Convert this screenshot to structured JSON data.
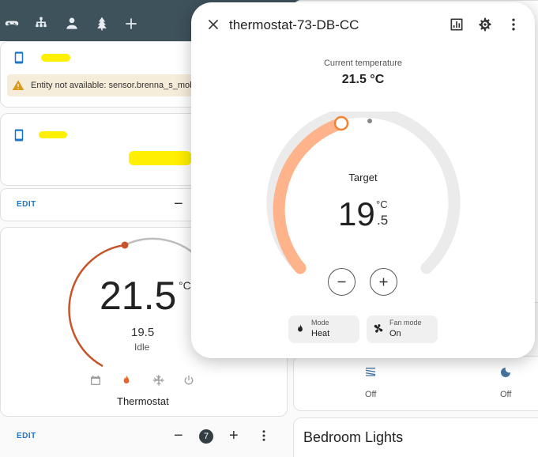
{
  "warning": {
    "text": "Entity not available: sensor.brenna_s_mobile"
  },
  "edit_label": "EDIT",
  "thermostat_card": {
    "current_temp": "21.5",
    "unit": "°C",
    "target": "19.5",
    "action": "Idle",
    "name": "Thermostat"
  },
  "bottom_bar": {
    "badge_count": "7"
  },
  "right_cards": {
    "off_label_1": "Off",
    "off_label_2": "Off"
  },
  "bedroom": {
    "title": "Bedroom Lights"
  },
  "dialog": {
    "title": "thermostat-73-DB-CC",
    "current_label": "Current temperature",
    "current_value": "21.5 °C",
    "target_label": "Target",
    "target_int": "19",
    "target_unit": "°C",
    "target_dec": ".5",
    "mode_chip": {
      "label": "Mode",
      "value": "Heat"
    },
    "fan_chip": {
      "label": "Fan mode",
      "value": "On"
    }
  },
  "colors": {
    "accent_heat": "#f58133",
    "arc_fill": "#ffb38a",
    "arc_track": "#ebebeb",
    "primary_blue": "#1e76c9",
    "topbar": "#3e525c"
  },
  "icons": {
    "topbar": [
      "gamepad-icon",
      "network-icon",
      "person-icon",
      "tree-icon",
      "plus-icon"
    ],
    "dialog_actions": [
      "history-chart-icon",
      "settings-gear-icon",
      "more-vert-icon"
    ]
  }
}
